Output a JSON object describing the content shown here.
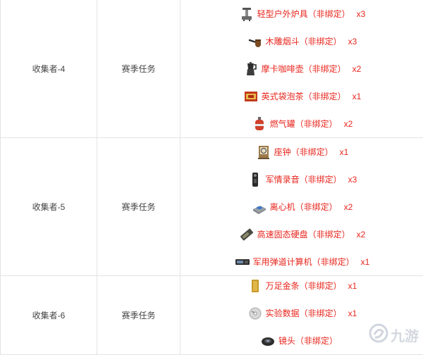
{
  "rows": [
    {
      "collector": "收集者-4",
      "type": "赛季任务",
      "items": [
        {
          "icon": "camping-stove-icon",
          "name": "轻型户外炉具（非绑定）",
          "qty": "x3"
        },
        {
          "icon": "tobacco-pipe-icon",
          "name": "木雕烟斗（非绑定）",
          "qty": "x3"
        },
        {
          "icon": "moka-pot-icon",
          "name": "摩卡咖啡壶（非绑定）",
          "qty": "x2"
        },
        {
          "icon": "tea-box-icon",
          "name": "英式袋泡茶（非绑定）",
          "qty": "x1"
        },
        {
          "icon": "gas-canister-icon",
          "name": "燃气罐（非绑定）",
          "qty": "x2"
        }
      ]
    },
    {
      "collector": "收集者-5",
      "type": "赛季任务",
      "items": [
        {
          "icon": "desk-clock-icon",
          "name": "座钟（非绑定）",
          "qty": "x1"
        },
        {
          "icon": "voice-recorder-icon",
          "name": "军情录音（非绑定）",
          "qty": "x3"
        },
        {
          "icon": "centrifuge-icon",
          "name": "离心机（非绑定）",
          "qty": "x2"
        },
        {
          "icon": "ssd-icon",
          "name": "高速固态硬盘（非绑定）",
          "qty": "x2"
        },
        {
          "icon": "ballistic-computer-icon",
          "name": "军用弹道计算机（非绑定）",
          "qty": "x1"
        }
      ]
    },
    {
      "collector": "收集者-6",
      "type": "赛季任务",
      "items": [
        {
          "icon": "gold-bar-icon",
          "name": "万足金条（非绑定）",
          "qty": "x1"
        },
        {
          "icon": "data-disc-icon",
          "name": "实验数据（非绑定）",
          "qty": "x1"
        },
        {
          "icon": "lens-icon",
          "name": "镜头（非绑定）",
          "qty": ""
        }
      ]
    }
  ],
  "watermark": {
    "text": "九游",
    "icon": "jiuyou-logo-icon"
  }
}
